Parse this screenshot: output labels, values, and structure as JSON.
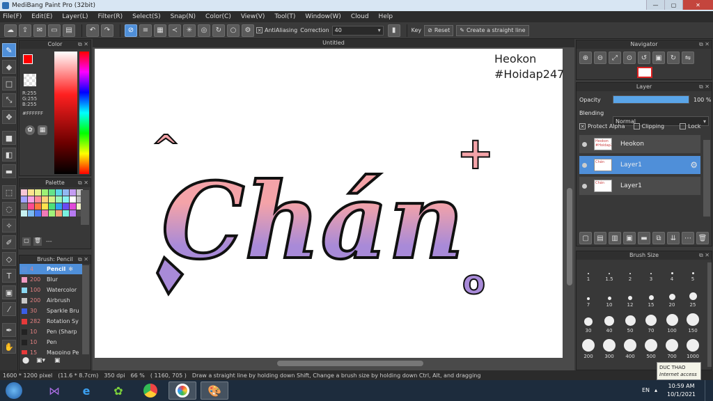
{
  "window": {
    "title": "MediBang Paint Pro (32bit)",
    "minimize": "—",
    "maximize": "▢",
    "close": "✕"
  },
  "menu": [
    "File(F)",
    "Edit(E)",
    "Layer(L)",
    "Filter(R)",
    "Select(S)",
    "Snap(N)",
    "Color(C)",
    "View(V)",
    "Tool(T)",
    "Window(W)",
    "Cloud",
    "Help"
  ],
  "toolbar": {
    "antialias_label": "AntiAliasing",
    "correction_label": "Correction",
    "correction_value": "40",
    "key_label": "Key",
    "reset_label": "Reset",
    "straight_line_label": "Create a straight line"
  },
  "color_panel": {
    "title": "Color",
    "r": "R:255",
    "g": "G:255",
    "b": "B:255",
    "hex": "#FFFFFF",
    "primary_color": "#ff0000",
    "secondary_color": "#ffffff"
  },
  "palette_panel": {
    "title": "Palette",
    "footer": "---",
    "colors": [
      "#f7c6d6",
      "#fbe38e",
      "#e6f18b",
      "#9df176",
      "#64e38a",
      "#5dd6e7",
      "#92b7f2",
      "#c49cf2",
      "#c7c7c7",
      "#a1a1ff",
      "#f7a1e3",
      "#ff8a9a",
      "#ffd27a",
      "#d7f28a",
      "#9ef7b7",
      "#88f2f2",
      "#ffffff",
      "#bdbdbd",
      "#7a7a7a",
      "#ff4b8f",
      "#ff7a3d",
      "#ffe24d",
      "#4be07a",
      "#2ea3f2",
      "#6b4bf2",
      "#e04bd9",
      "#f2f2c8",
      "#c8f2f2",
      "#7ab8f2",
      "#4b7af2",
      "#f27ab8",
      "#a1f27a",
      "#f2a17a",
      "#7af2e0",
      "#b77af2",
      "#4b4b4b"
    ]
  },
  "brush_panel": {
    "title": "Brush: Pencil",
    "items": [
      {
        "size": "4",
        "name": "Pencil",
        "color": "#5b8fd8",
        "selected": true
      },
      {
        "size": "200",
        "name": "Blur",
        "color": "#f09ac2"
      },
      {
        "size": "100",
        "name": "Watercolor",
        "color": "#8ad8f2"
      },
      {
        "size": "200",
        "name": "Airbrush",
        "color": "#c8c8c8"
      },
      {
        "size": "30",
        "name": "Sparkle Bru",
        "color": "#3a5ee6"
      },
      {
        "size": "282",
        "name": "Rotation Sy",
        "color": "#e63a3a"
      },
      {
        "size": "10",
        "name": "Pen (Sharp",
        "color": "#222222"
      },
      {
        "size": "10",
        "name": "Pen",
        "color": "#222222"
      },
      {
        "size": "15",
        "name": "Mapping Pe",
        "color": "#e63a3a"
      }
    ]
  },
  "document": {
    "tab": "Untitled",
    "watermark_line1": "Heokon",
    "watermark_line2": "#Hoidap247",
    "caret_top": "^",
    "plus": "+",
    "main_word": "Chán",
    "small_o": "o"
  },
  "navigator": {
    "title": "Navigator"
  },
  "layer_panel": {
    "title": "Layer",
    "opacity_label": "Opacity",
    "opacity_value": "100 %",
    "opacity_level": 1.0,
    "blending_label": "Blending",
    "blending_value": "Normal",
    "protect_alpha": "Protect Alpha",
    "clipping": "Clipping",
    "lock": "Lock",
    "layers": [
      {
        "name": "Heokon",
        "thumb": "Heokon #Hoidap247",
        "selected": false
      },
      {
        "name": "Layer1",
        "thumb": "Chán",
        "selected": true
      },
      {
        "name": "Layer1",
        "thumb": "Chán",
        "selected": false
      }
    ]
  },
  "brush_size_panel": {
    "title": "Brush Size",
    "sizes": [
      "1",
      "1.5",
      "2",
      "3",
      "4",
      "5",
      "7",
      "10",
      "12",
      "15",
      "20",
      "25",
      "30",
      "40",
      "50",
      "70",
      "100",
      "150",
      "200",
      "300",
      "400",
      "500",
      "700",
      "1000"
    ]
  },
  "status": {
    "dimensions": "1600 * 1200 pixel",
    "physical": "(11.6 * 8.7cm)",
    "dpi": "350 dpi",
    "zoom": "66 %",
    "coords": "( 1160, 705 )",
    "hint": "Draw a straight line by holding down Shift, Change a brush size by holding down Ctrl, Alt, and dragging"
  },
  "taskbar": {
    "tooltip_name": "DUC THAO",
    "tooltip_sub": "Internet access",
    "lang": "EN",
    "time": "10:59 AM",
    "date": "10/1/2021"
  }
}
